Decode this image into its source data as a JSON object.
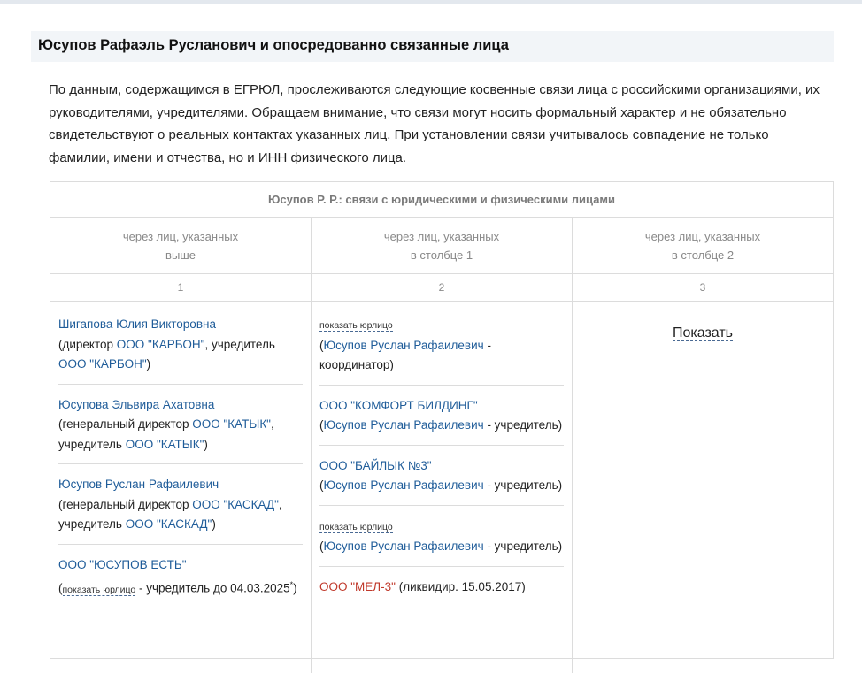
{
  "section": {
    "title": "Юсупов Рафаэль Русланович и опосредованно связанные лица"
  },
  "intro": {
    "text": "По данным, содержащимся в ЕГРЮЛ, прослеживаются следующие косвенные связи лица с российскими организациями, их руководителями, учредителями. Обращаем внимание, что связи могут носить формальный характер и не обязательно свидетельствуют о реальных контактах указанных лиц. При установлении связи учитывалось совпадение не только фамилии, имени и отчества, но и ИНН физического лица."
  },
  "panel": {
    "title": "Юсупов Р. Р.: связи с юридическими и физическими лицами",
    "columns": [
      {
        "line1": "через лиц, указанных",
        "line2": "выше",
        "num": "1"
      },
      {
        "line1": "через лиц, указанных",
        "line2": "в столбце 1",
        "num": "2"
      },
      {
        "line1": "через лиц, указанных",
        "line2": "в столбце 2",
        "num": "3"
      }
    ]
  },
  "col1": {
    "e1": {
      "name": "Шигапова Юлия Викторовна",
      "p1": "(директор ",
      "org1": "ООО \"КАРБОН\"",
      "p2": ", учредитель ",
      "org2": "ООО \"КАРБОН\"",
      "p3": ")"
    },
    "e2": {
      "name": "Юсупова Эльвира Ахатовна",
      "p1": "(генеральный директор ",
      "org1": "ООО \"КАТЫК\"",
      "p2": ", учредитель ",
      "org2": "ООО \"КАТЫК\"",
      "p3": ")"
    },
    "e3": {
      "name": "Юсупов Руслан Рафаилевич",
      "p1": "(генеральный директор ",
      "org1": "ООО \"КАСКАД\"",
      "p2": ", учредитель ",
      "org2": "ООО \"КАСКАД\"",
      "p3": ")"
    },
    "e4": {
      "name": "ООО \"ЮСУПОВ ЕСТЬ\"",
      "p1": "(",
      "show": "показать юрлицо",
      "p2": " - учредитель до 04.03.2025",
      "sup": "*",
      "p3": ")"
    }
  },
  "col2": {
    "e1": {
      "show": "показать юрлицо",
      "p1": "(",
      "person": "Юсупов Руслан Рафаилевич",
      "p2": " - координатор)"
    },
    "e2": {
      "org": "ООО \"КОМФОРТ БИЛДИНГ\"",
      "p1": "(",
      "person": "Юсупов Руслан Рафаилевич",
      "p2": " - учредитель)"
    },
    "e3": {
      "org": "ООО \"БАЙЛЫК №3\"",
      "p1": "(",
      "person": "Юсупов Руслан Рафаилевич",
      "p2": " - учредитель)"
    },
    "e4": {
      "show": "показать юрлицо",
      "p1": "(",
      "person": "Юсупов Руслан Рафаилевич",
      "p2": " - учредитель)"
    },
    "e5": {
      "org": "ООО \"МЕЛ-3\"",
      "p1": " (ликвидир. 15.05.2017)"
    }
  },
  "col3": {
    "show_label": "Показать"
  },
  "colors": {
    "link": "#1f5c99",
    "liquidated": "#c0392b",
    "border": "#dcdcdc",
    "title_bg": "#f2f5f8"
  }
}
